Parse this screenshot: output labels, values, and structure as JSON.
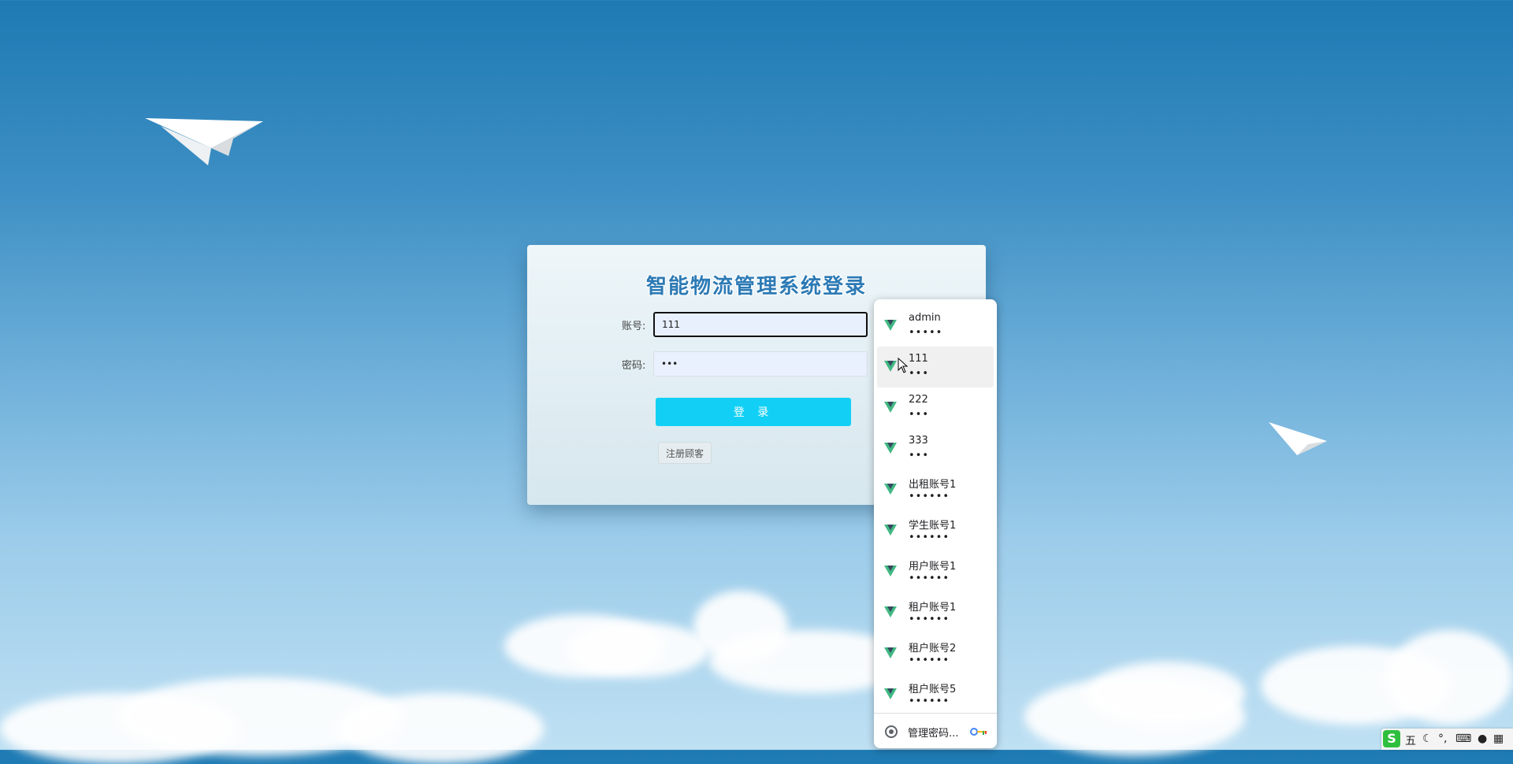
{
  "page": {
    "title": "智能物流管理系统登录"
  },
  "login_form": {
    "account_label": "账号:",
    "account_value": "111",
    "password_label": "密码:",
    "password_value": "•••",
    "login_button": "登 录",
    "register_button": "注册顾客"
  },
  "autofill": {
    "credentials": [
      {
        "username": "admin",
        "password": "•••••"
      },
      {
        "username": "111",
        "password": "•••"
      },
      {
        "username": "222",
        "password": "•••"
      },
      {
        "username": "333",
        "password": "•••"
      },
      {
        "username": "出租账号1",
        "password": "••••••"
      },
      {
        "username": "学生账号1",
        "password": "••••••"
      },
      {
        "username": "用户账号1",
        "password": "••••••"
      },
      {
        "username": "租户账号1",
        "password": "••••••"
      },
      {
        "username": "租户账号2",
        "password": "••••••"
      },
      {
        "username": "租户账号5",
        "password": "••••••"
      }
    ],
    "hovered_index": 1,
    "manage_label": "管理密码..."
  },
  "ime_toolbar": {
    "mode": "五"
  },
  "colors": {
    "login_button": "#12d0f5",
    "title": "#2c7ab5",
    "vue_green": "#42b883",
    "vue_dark": "#35495e"
  }
}
